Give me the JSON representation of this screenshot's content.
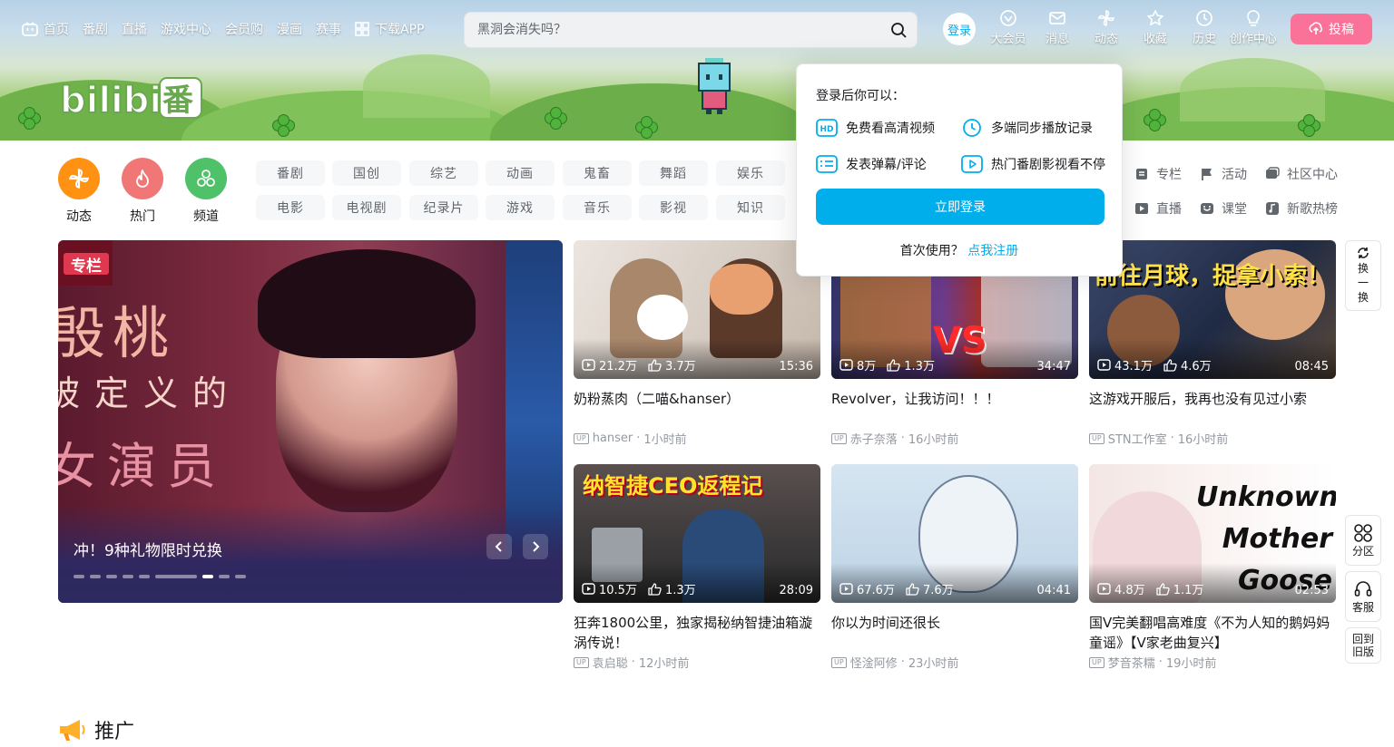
{
  "nav": {
    "items": [
      {
        "label": "首页",
        "icon": "tv-icon"
      },
      {
        "label": "番剧"
      },
      {
        "label": "直播"
      },
      {
        "label": "游戏中心"
      },
      {
        "label": "会员购"
      },
      {
        "label": "漫画"
      },
      {
        "label": "赛事"
      },
      {
        "label": "下载APP",
        "icon": "app-grid-icon"
      }
    ]
  },
  "search": {
    "placeholder": "黑洞会消失吗？"
  },
  "user": {
    "login_label": "登录"
  },
  "nav_right": [
    {
      "label": "大会员",
      "icon": "vip-icon"
    },
    {
      "label": "消息",
      "icon": "mail-icon"
    },
    {
      "label": "动态",
      "icon": "windmill-icon"
    },
    {
      "label": "收藏",
      "icon": "star-icon"
    },
    {
      "label": "历史",
      "icon": "clock-icon"
    },
    {
      "label": "创作中心",
      "icon": "bulb-icon"
    }
  ],
  "upload": {
    "label": "投稿"
  },
  "quick": [
    {
      "label": "动态",
      "color": "#ff9212"
    },
    {
      "label": "热门",
      "color": "#f07775"
    },
    {
      "label": "频道",
      "color": "#4ec169"
    }
  ],
  "channels": {
    "row1": [
      "番剧",
      "国创",
      "综艺",
      "动画",
      "鬼畜",
      "舞蹈",
      "娱乐"
    ],
    "row2": [
      "电影",
      "电视剧",
      "纪录片",
      "游戏",
      "音乐",
      "影视",
      "知识"
    ]
  },
  "side_links": [
    {
      "label": "专栏",
      "icon": "column-icon"
    },
    {
      "label": "活动",
      "icon": "flag-icon"
    },
    {
      "label": "社区中心",
      "icon": "community-icon"
    },
    {
      "label": "直播",
      "icon": "live-icon"
    },
    {
      "label": "课堂",
      "icon": "class-icon"
    },
    {
      "label": "新歌热榜",
      "icon": "music-icon"
    }
  ],
  "carousel": {
    "caption": "冲！9种礼物限时兑换",
    "tag": "专栏",
    "overlay_lines": [
      "殷桃",
      "被定义的",
      "女演员"
    ]
  },
  "videos": [
    {
      "title": "奶粉蒸肉（二喵&hanser）",
      "author": "hanser",
      "time": "1小时前",
      "views": "21.2万",
      "likes": "3.7万",
      "duration": "15:36",
      "bg": "#d9cfc7"
    },
    {
      "title": "Revolver，让我访问！！！",
      "author": "赤子奈落",
      "time": "16小时前",
      "views": "8万",
      "likes": "1.3万",
      "duration": "34:47",
      "bg": "#5a3c8a",
      "thumb_text": "VS"
    },
    {
      "title": "这游戏开服后，我再也没有见过小索",
      "author": "STN工作室",
      "time": "16小时前",
      "views": "43.1万",
      "likes": "4.6万",
      "duration": "08:45",
      "bg": "#2b3550",
      "thumb_text": "前往月球，捉拿小索！"
    },
    {
      "title": "狂奔1800公里，独家揭秘纳智捷油箱漩涡传说！",
      "author": "袁启聪",
      "time": "12小时前",
      "views": "10.5万",
      "likes": "1.3万",
      "duration": "28:09",
      "bg": "#3d3a3a",
      "thumb_text": "纳智捷CEO返程记"
    },
    {
      "title": "你以为时间还很长",
      "author": "怪淦阿修",
      "time": "23小时前",
      "views": "67.6万",
      "likes": "7.6万",
      "duration": "04:41",
      "bg": "#c9dcec"
    },
    {
      "title": "国V完美翻唱高难度《不为人知的鹅妈妈童谣》【V家老曲复兴】",
      "author": "梦音茶糯",
      "time": "19小时前",
      "views": "4.8万",
      "likes": "1.1万",
      "duration": "02:53",
      "bg": "#f4ece9",
      "thumb_text": "Unknown Mother Goose"
    }
  ],
  "rail": {
    "refresh": "换一换",
    "zone": "分区",
    "service": "客服",
    "old": "回到旧版"
  },
  "popover": {
    "title": "登录后你可以：",
    "features": [
      {
        "label": "免费看高清视频",
        "icon": "hd-icon"
      },
      {
        "label": "多端同步播放记录",
        "icon": "sync-clock-icon"
      },
      {
        "label": "发表弹幕/评论",
        "icon": "danmaku-icon"
      },
      {
        "label": "热门番剧影视看不停",
        "icon": "play-box-icon"
      }
    ],
    "login_button": "立即登录",
    "first_use": "首次使用？",
    "register": "点我注册"
  },
  "promo": {
    "title": "推广"
  },
  "brand": {
    "accent": "#00aeec",
    "pink": "#fb7299"
  }
}
